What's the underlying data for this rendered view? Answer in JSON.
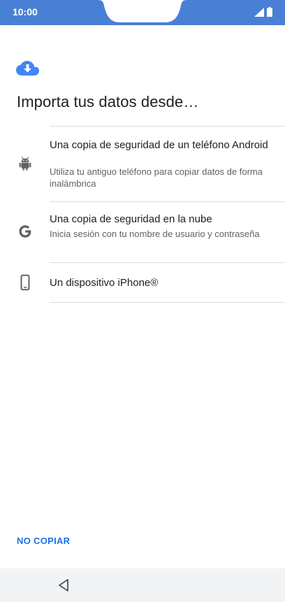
{
  "status_bar": {
    "time": "10:00",
    "color": "#4a7fd6",
    "icons": [
      "signal-icon",
      "battery-icon"
    ]
  },
  "header": {
    "icon": "cloud-download-icon",
    "accent": "#4285f4",
    "title": "Importa tus datos desde…"
  },
  "options": [
    {
      "icon": "android-icon",
      "title": "Una copia de seguridad de un teléfono Android",
      "subtitle": "Utiliza tu antiguo teléfono para copiar datos de forma inalámbrica"
    },
    {
      "icon": "google-icon",
      "title": "Una copia de seguridad en la nube",
      "subtitle": "Inicia sesión con tu nombre de usuario y contraseña"
    },
    {
      "icon": "phone-icon",
      "title": "Un dispositivo iPhone®",
      "subtitle": ""
    }
  ],
  "footer": {
    "skip_label": "NO COPIAR",
    "link_color": "#1a73e8"
  },
  "nav_bar": {
    "icons": [
      "back-icon"
    ]
  }
}
